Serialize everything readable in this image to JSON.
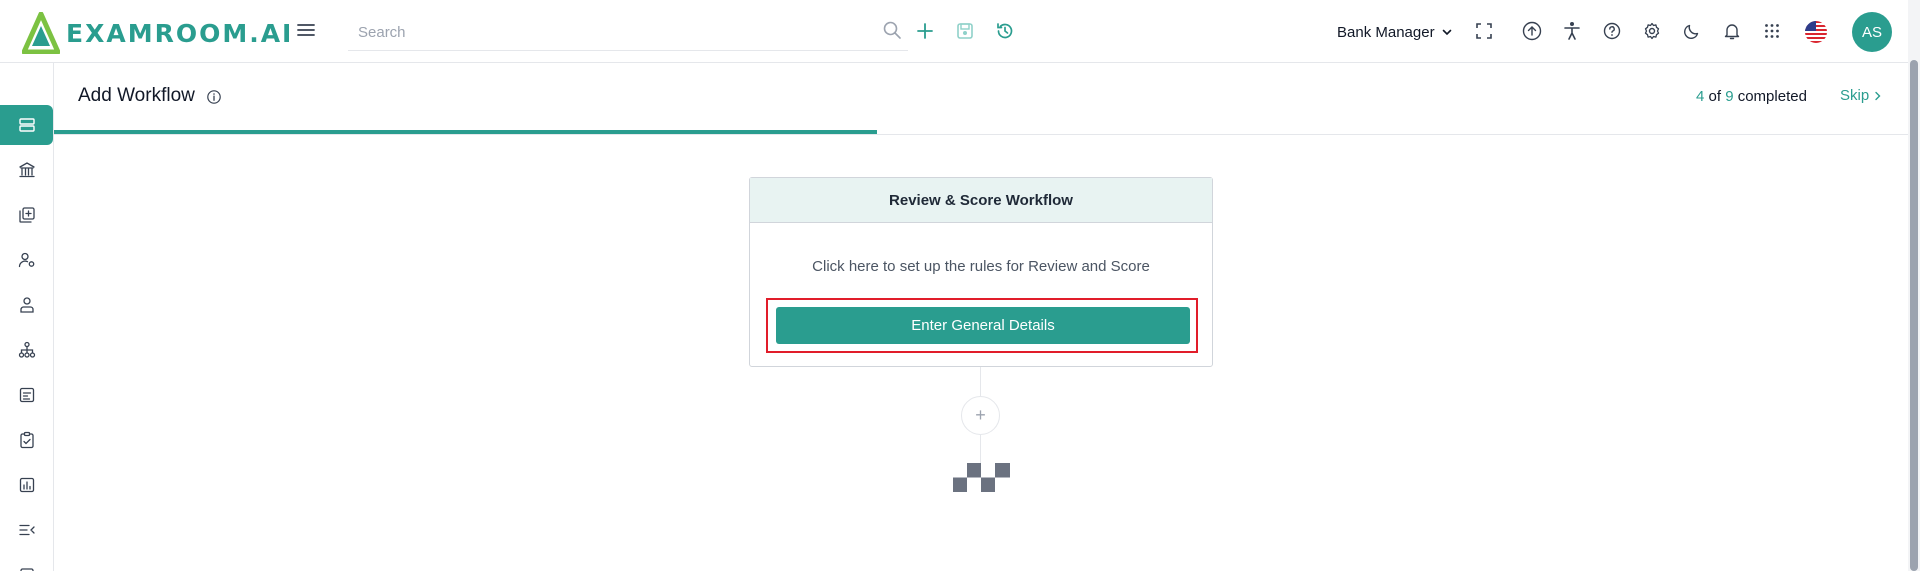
{
  "brand": {
    "name": "EXAMROOM.AI",
    "color": "#2a9d8f"
  },
  "header": {
    "search_placeholder": "Search",
    "role": "Bank Manager",
    "avatar_initials": "AS",
    "icons": [
      "add-icon",
      "save-icon",
      "history-icon",
      "fullscreen-icon",
      "upload-icon",
      "accessibility-icon",
      "help-icon",
      "settings-icon",
      "dark-mode-icon",
      "notifications-icon",
      "apps-grid-icon",
      "us-flag-icon"
    ]
  },
  "sidebar": {
    "items": [
      {
        "icon": "workflow-icon",
        "active": true
      },
      {
        "icon": "bank-icon",
        "active": false
      },
      {
        "icon": "add-document-icon",
        "active": false
      },
      {
        "icon": "user-settings-icon",
        "active": false
      },
      {
        "icon": "user-icon",
        "active": false
      },
      {
        "icon": "hierarchy-icon",
        "active": false
      },
      {
        "icon": "form-icon",
        "active": false
      },
      {
        "icon": "clipboard-check-icon",
        "active": false
      },
      {
        "icon": "report-chart-icon",
        "active": false
      },
      {
        "icon": "collapse-menu-icon",
        "active": false
      },
      {
        "icon": "more-icon",
        "active": false
      }
    ]
  },
  "page": {
    "title": "Add Workflow",
    "progress": {
      "current": "4",
      "of_label": "of",
      "total": "9",
      "completed_label": "completed",
      "fraction": 0.444
    },
    "skip_label": "Skip"
  },
  "workflow": {
    "card_title": "Review & Score Workflow",
    "description": "Click here to set up the rules for Review and Score",
    "button_label": "Enter General Details",
    "add_node_label": "+"
  },
  "colors": {
    "accent": "#2a9d8f",
    "highlight": "#e11d2a",
    "card_header": "#e8f3f2"
  }
}
